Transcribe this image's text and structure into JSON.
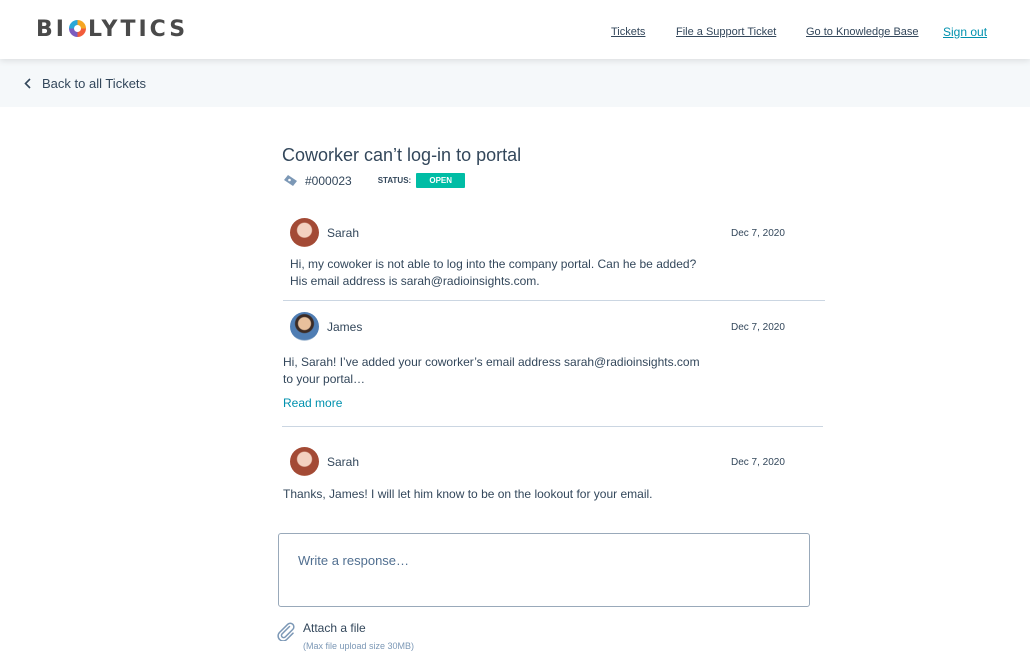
{
  "header": {
    "logo": {
      "before": "BI",
      "after": "LYTICS"
    },
    "nav": {
      "tickets": "Tickets",
      "file_ticket": "File a Support Ticket",
      "knowledge_base": "Go to Knowledge Base",
      "sign_out": "Sign out"
    }
  },
  "back": {
    "label": "Back to all Tickets"
  },
  "ticket": {
    "title": "Coworker can’t log-in to portal",
    "number": "#000023",
    "status_label": "STATUS:",
    "status": "OPEN",
    "status_color": "#00bda5"
  },
  "messages": [
    {
      "author": "Sarah",
      "date": "Dec 7, 2020",
      "body": "Hi,  my cowoker is not able to log into the company portal. Can he be added?\nHis email address is sarah@radioinsights.com."
    },
    {
      "author": "James",
      "date": "Dec 7, 2020",
      "body": "Hi, Sarah! I’ve added your coworker’s email address sarah@radioinsights.com\nto your portal…",
      "read_more": "Read more"
    },
    {
      "author": "Sarah",
      "date": "Dec 7, 2020",
      "body": "Thanks, James! I will let him know to be on the lookout for your email."
    }
  ],
  "response": {
    "placeholder": "Write a response…"
  },
  "attach": {
    "label": "Attach a file",
    "note": "(Max file upload size 30MB)"
  },
  "icons": {
    "back": "chevron-left-icon",
    "ticket": "ticket-icon",
    "attach": "paperclip-icon"
  },
  "colors": {
    "link": "#0091ae",
    "text": "#33475b",
    "accent": "#00bda5"
  }
}
